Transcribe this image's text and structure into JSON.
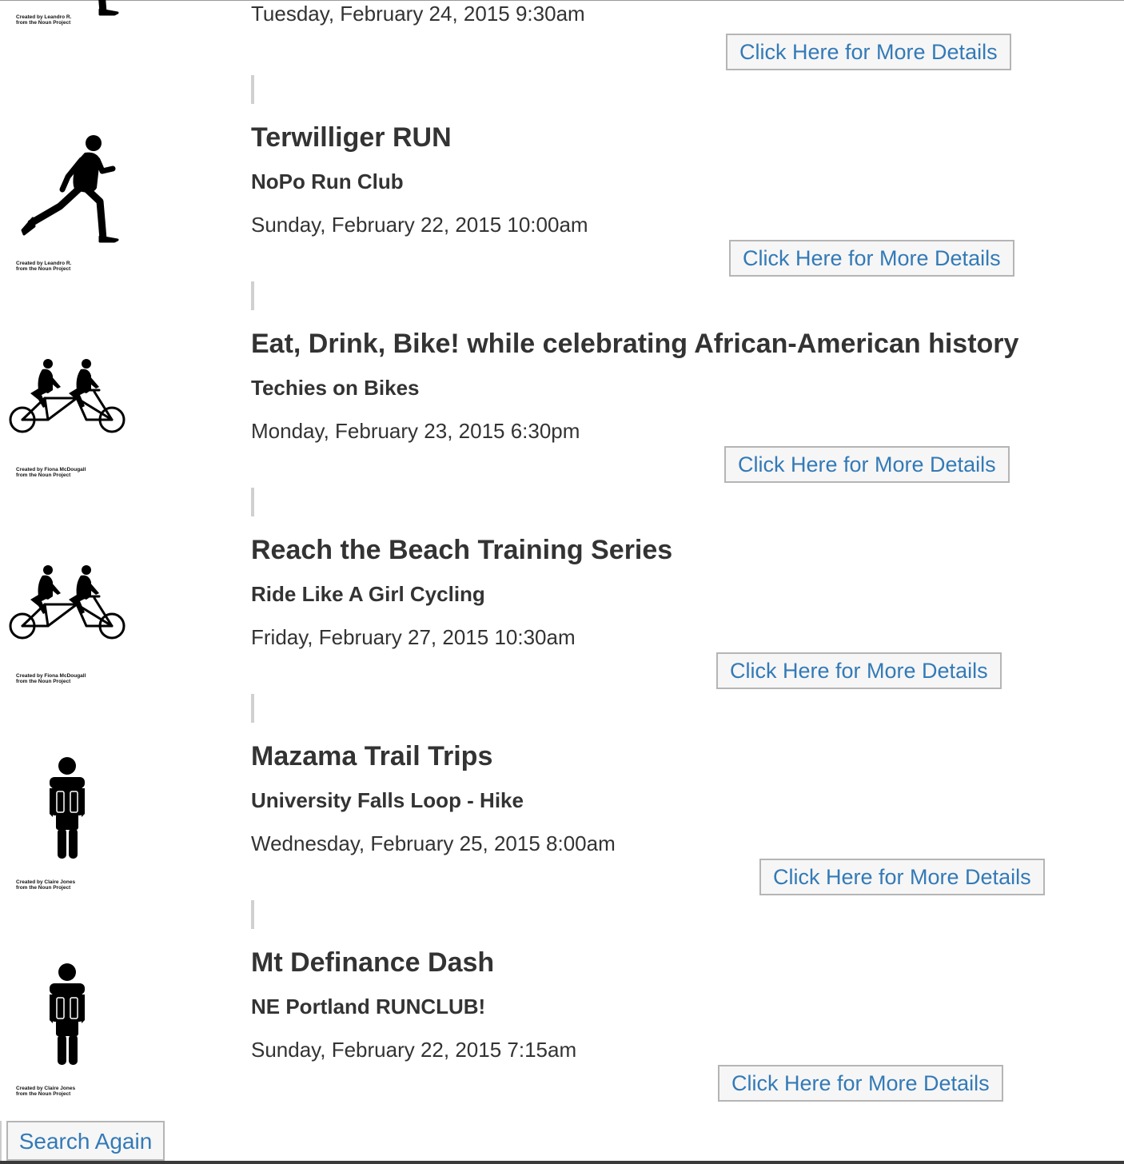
{
  "partial_event": {
    "date": "Tuesday, February 24, 2015 9:30am",
    "details_label": "Click Here for More Details",
    "icon": "runner-icon",
    "credit_line1": "Created by Leandro R.",
    "credit_line2": "from the Noun Project"
  },
  "events": [
    {
      "title": "Terwilliger RUN",
      "club": "NoPo Run Club",
      "date": "Sunday, February 22, 2015 10:00am",
      "details_label": "Click Here for More Details",
      "icon": "runner-icon",
      "credit_line1": "Created by Leandro R.",
      "credit_line2": "from the Noun Project"
    },
    {
      "title": "Eat, Drink, Bike! while celebrating African-American history",
      "club": "Techies on Bikes",
      "date": "Monday, February 23, 2015 6:30pm",
      "details_label": "Click Here for More Details",
      "icon": "tandem-bicycle-icon",
      "credit_line1": "Created by Fiona McDougall",
      "credit_line2": "from the Noun Project"
    },
    {
      "title": "Reach the Beach Training Series",
      "club": "Ride Like A Girl Cycling",
      "date": "Friday, February 27, 2015 10:30am",
      "details_label": "Click Here for More Details",
      "icon": "tandem-bicycle-icon",
      "credit_line1": "Created by Fiona McDougall",
      "credit_line2": "from the Noun Project"
    },
    {
      "title": "Mazama Trail Trips",
      "club": "University Falls Loop - Hike",
      "date": "Wednesday, February 25, 2015 8:00am",
      "details_label": "Click Here for More Details",
      "icon": "hiker-backpack-icon",
      "credit_line1": "Created by Claire Jones",
      "credit_line2": "from the Noun Project"
    },
    {
      "title": "Mt Definance Dash",
      "club": "NE Portland RUNCLUB!",
      "date": "Sunday, February 22, 2015 7:15am",
      "details_label": "Click Here for More Details",
      "icon": "hiker-backpack-icon",
      "credit_line1": "Created by Claire Jones",
      "credit_line2": "from the Noun Project"
    }
  ],
  "search_again_label": "Search Again",
  "colors": {
    "link": "#337ab7",
    "text": "#333333",
    "button_bg": "#f6f6f6",
    "button_border": "#b5b5b5"
  }
}
